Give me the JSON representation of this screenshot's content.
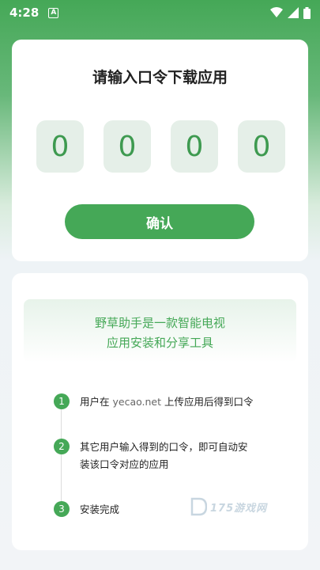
{
  "status_bar": {
    "time": "4:28",
    "notification_letter": "A"
  },
  "title": "请输入口令下载应用",
  "code_digits": [
    "0",
    "0",
    "0",
    "0"
  ],
  "confirm_label": "确认",
  "intro": {
    "line1": "野草助手是一款智能电视",
    "line2": "应用安装和分享工具"
  },
  "steps": [
    {
      "num": "1",
      "prefix": "用户在 ",
      "url": "yecao.net",
      "suffix": " 上传应用后得到口令"
    },
    {
      "num": "2",
      "line1": "其它用户输入得到的口令，即可自动安",
      "line2": "装该口令对应的应用"
    },
    {
      "num": "3",
      "text": "安装完成"
    }
  ],
  "watermark": "175游戏网",
  "colors": {
    "accent": "#45a857",
    "code_bg": "#e5efe8"
  }
}
